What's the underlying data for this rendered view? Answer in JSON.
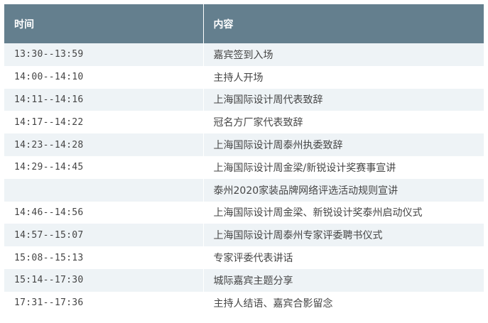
{
  "header": {
    "time": "时间",
    "content": "内容"
  },
  "rows": [
    {
      "time": "13:30--13:59",
      "content": "嘉宾签到入场"
    },
    {
      "time": "14:00--14:10",
      "content": "主持人开场"
    },
    {
      "time": "14:11--14:16",
      "content": "上海国际设计周代表致辞"
    },
    {
      "time": "14:17--14:22",
      "content": "冠名方厂家代表致辞"
    },
    {
      "time": "14:23--14:28",
      "content": "上海国际设计周泰州执委致辞"
    },
    {
      "time": "14:29--14:45",
      "content": "上海国际设计周金梁/新锐设计奖赛事宣讲"
    },
    {
      "time": "",
      "content": "泰州2020家装品牌网络评选活动规则宣讲"
    },
    {
      "time": "14:46--14:56",
      "content": "上海国际设计周金梁、新锐设计奖泰州启动仪式"
    },
    {
      "time": "14:57--15:07",
      "content": "上海国际设计周泰州专家评委聘书仪式"
    },
    {
      "time": "15:08--15:13",
      "content": "专家评委代表讲话"
    },
    {
      "time": "15:14--17:30",
      "content": "城际嘉宾主题分享"
    },
    {
      "time": "17:31--17:36",
      "content": "主持人结语、嘉宾合影留念"
    }
  ],
  "colors": {
    "header_bg": "#647f8e",
    "stripe_bg": "#eef3f6",
    "text": "#454545"
  }
}
